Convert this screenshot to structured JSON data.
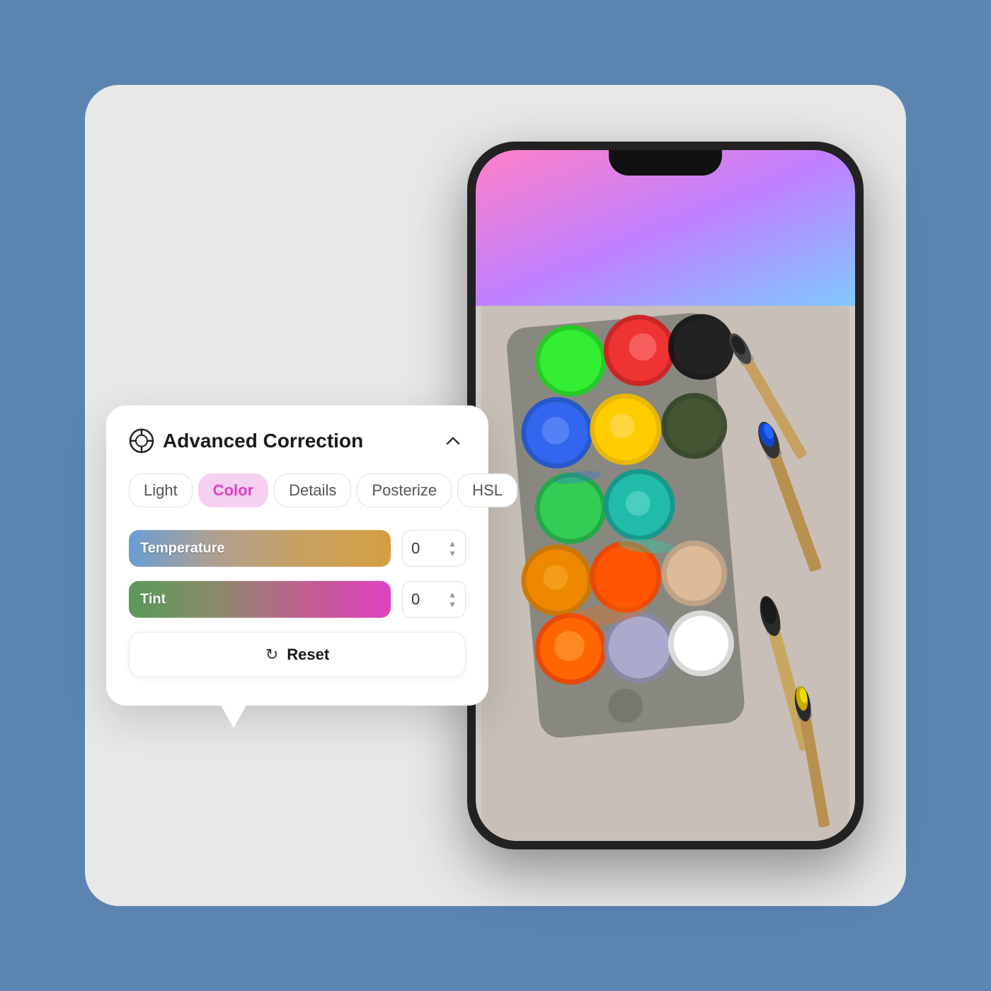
{
  "background_color": "#5b84b1",
  "card": {
    "background_color": "#e8e8e8",
    "border_radius": "48px"
  },
  "panel": {
    "title": "Advanced Correction",
    "icon_name": "correction-icon",
    "tabs": [
      {
        "id": "light",
        "label": "Light",
        "active": false
      },
      {
        "id": "color",
        "label": "Color",
        "active": true
      },
      {
        "id": "details",
        "label": "Details",
        "active": false
      },
      {
        "id": "posterize",
        "label": "Posterize",
        "active": false
      },
      {
        "id": "hsl",
        "label": "HSL",
        "active": false
      }
    ],
    "sliders": [
      {
        "id": "temperature",
        "label": "Temperature",
        "value": "0",
        "gradient_start": "#6a9ed4",
        "gradient_end": "#d4a040"
      },
      {
        "id": "tint",
        "label": "Tint",
        "value": "0",
        "gradient_start": "#5a9a5a",
        "gradient_end": "#e040c0"
      }
    ],
    "reset_button": {
      "label": "Reset"
    },
    "collapse_button_label": "^"
  },
  "phone": {
    "gradient_colors": [
      "#ff80c8",
      "#c080ff",
      "#80c8ff"
    ]
  }
}
